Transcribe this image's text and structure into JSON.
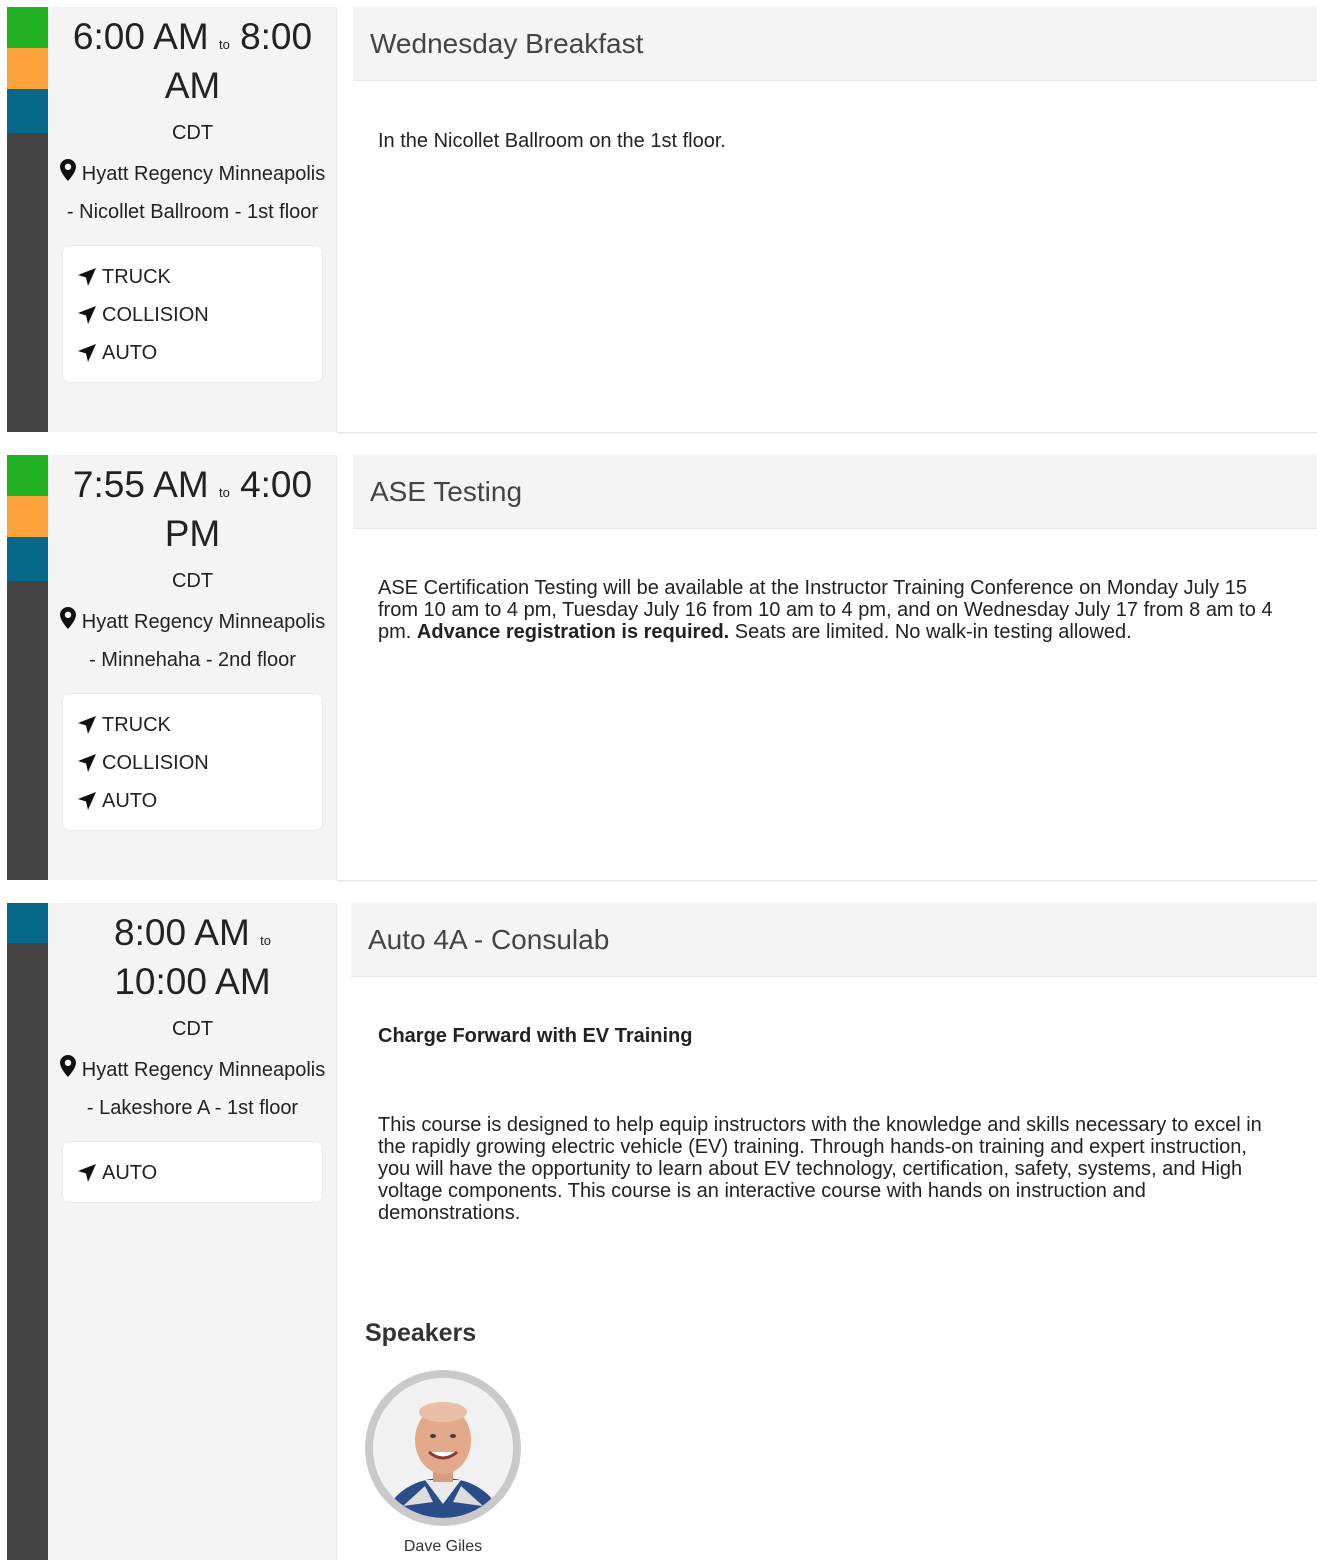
{
  "colors": {
    "green": "#22b122",
    "orange": "#fea43c",
    "teal": "#06698c",
    "dark": "#444444",
    "panel_bg": "#f4f4f4"
  },
  "sessions": [
    {
      "start": "6:00 AM",
      "to": "to",
      "end": "8:00 AM",
      "timezone": "CDT",
      "location": "Hyatt Regency Minneapolis - Nicollet Ballroom - 1st floor",
      "tracks": [
        "TRUCK",
        "COLLISION",
        "AUTO"
      ],
      "title": "Wednesday Breakfast",
      "description": "In the Nicollet Ballroom on the 1st floor."
    },
    {
      "start": "7:55 AM",
      "to": "to",
      "end": "4:00 PM",
      "timezone": "CDT",
      "location": "Hyatt Regency Minneapolis - Minnehaha - 2nd floor",
      "tracks": [
        "TRUCK",
        "COLLISION",
        "AUTO"
      ],
      "title": "ASE Testing",
      "description_before": "ASE Certification Testing will be available at the Instructor Training Conference on Monday July 15 from 10 am to 4 pm, Tuesday July 16 from 10 am to 4 pm, and on Wednesday July 17 from 8 am to 4 pm. ",
      "description_bold": "Advance registration is required.",
      "description_after": " Seats are limited. No walk-in testing allowed."
    },
    {
      "start": "8:00 AM",
      "to": "to",
      "end": "10:00 AM",
      "timezone": "CDT",
      "location": "Hyatt Regency Minneapolis - Lakeshore A - 1st floor",
      "tracks": [
        "AUTO"
      ],
      "title": "Auto 4A - Consulab",
      "course_title": "Charge Forward with EV Training",
      "description": "This course is designed to help equip instructors with the knowledge and skills necessary to excel in the rapidly growing electric vehicle (EV) training. Through hands-on training and expert instruction, you will have the opportunity to learn about EV technology, certification, safety, systems, and High voltage components. This course is an interactive course with hands on instruction and demonstrations.",
      "speakers_heading": "Speakers",
      "speakers": [
        {
          "name": "Dave Giles"
        }
      ]
    }
  ]
}
